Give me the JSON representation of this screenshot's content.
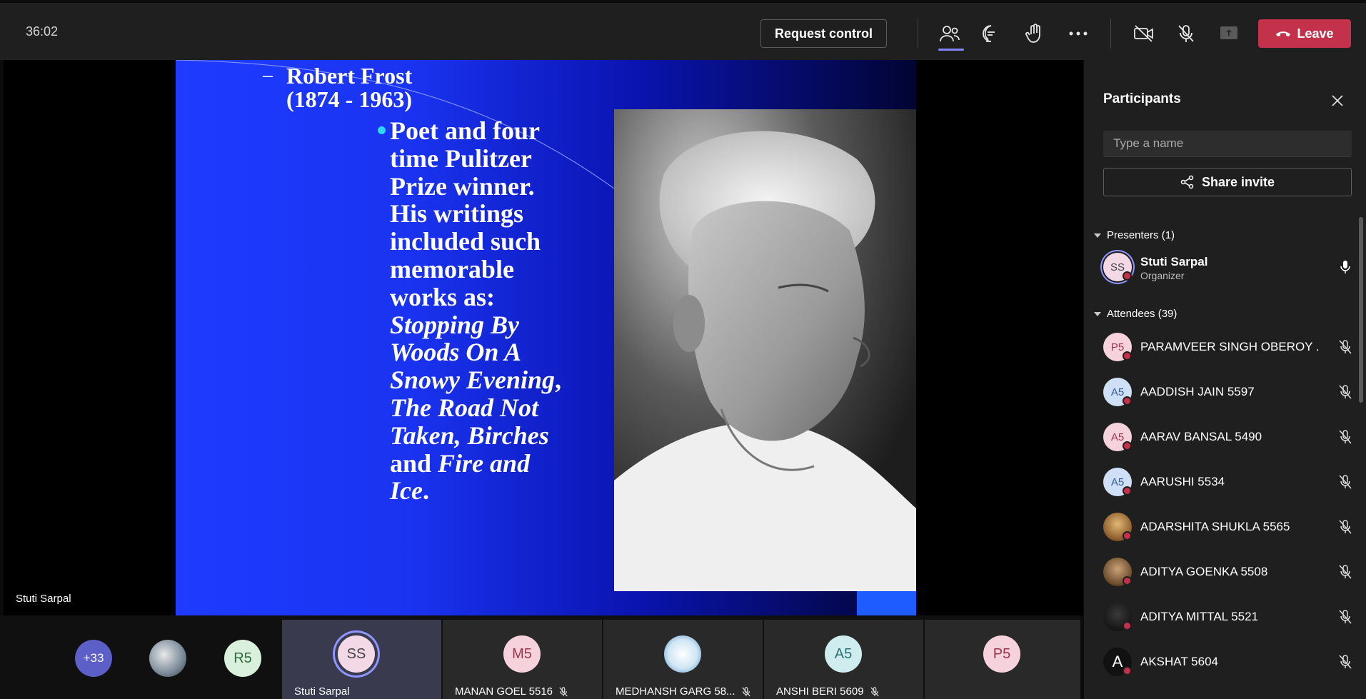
{
  "topbar": {
    "timer": "36:02",
    "request_control": "Request control",
    "leave": "Leave",
    "icons": [
      "people-icon",
      "chat-icon",
      "raise-hand-icon",
      "more-icon",
      "camera-off-icon",
      "mic-off-icon",
      "share-tray-icon"
    ]
  },
  "stage": {
    "presenter_name": "Stuti Sarpal",
    "slide": {
      "heading_line1": "Robert Frost",
      "heading_line2": "(1874 - 1963)",
      "dash": "–",
      "body": [
        {
          "t": "Poet and four",
          "i": false
        },
        {
          "t": "time Pulitzer",
          "i": false
        },
        {
          "t": "Prize winner.",
          "i": false
        },
        {
          "t": "His writings",
          "i": false
        },
        {
          "t": "included such",
          "i": false
        },
        {
          "t": "memorable",
          "i": false
        },
        {
          "t": "works as:",
          "i": false
        },
        {
          "t": "Stopping By",
          "i": true
        },
        {
          "t": "Woods On A",
          "i": true
        },
        {
          "t": "Snowy Evening",
          "i": true,
          "suffix": ","
        },
        {
          "t": "The Road Not",
          "i": true
        },
        {
          "t": "Taken, Birches",
          "i": true
        },
        {
          "t_plain": "and ",
          "t": "Fire and",
          "i": true
        },
        {
          "t": "Ice",
          "i": true,
          "suffix": "."
        }
      ]
    }
  },
  "gallery": {
    "overflow_count": "+33",
    "tiles": [
      {
        "initials": "R5",
        "name": ""
      },
      {
        "initials": "SS",
        "name": "Stuti Sarpal"
      },
      {
        "initials": "M5",
        "name": "MANAN GOEL 5516"
      },
      {
        "initials": "",
        "name": "MEDHANSH GARG 58..."
      },
      {
        "initials": "A5",
        "name": "ANSHI BERI 5609"
      },
      {
        "initials": "P5",
        "name": ""
      }
    ]
  },
  "panel": {
    "title": "Participants",
    "search_placeholder": "Type a name",
    "share_invite": "Share invite",
    "presenters_label": "Presenters (1)",
    "attendees_label": "Attendees (39)",
    "presenters": [
      {
        "initials": "SS",
        "name": "Stuti Sarpal",
        "role": "Organizer"
      }
    ],
    "attendees": [
      {
        "initials": "P5",
        "name": "PARAMVEER SINGH OBEROY ..."
      },
      {
        "initials": "A5",
        "name": "AADDISH JAIN 5597"
      },
      {
        "initials": "A5",
        "name": "AARAV BANSAL 5490"
      },
      {
        "initials": "A5",
        "name": "AARUSHI 5534"
      },
      {
        "initials": "",
        "name": "ADARSHITA SHUKLA 5565"
      },
      {
        "initials": "",
        "name": "ADITYA GOENKA 5508"
      },
      {
        "initials": "",
        "name": "ADITYA MITTAL 5521"
      },
      {
        "initials": "A",
        "name": "AKSHAT 5604"
      }
    ]
  },
  "colors": {
    "accent": "#7f85f5",
    "leave_red": "#c4314b",
    "bg_dark": "#1f1f1f"
  }
}
